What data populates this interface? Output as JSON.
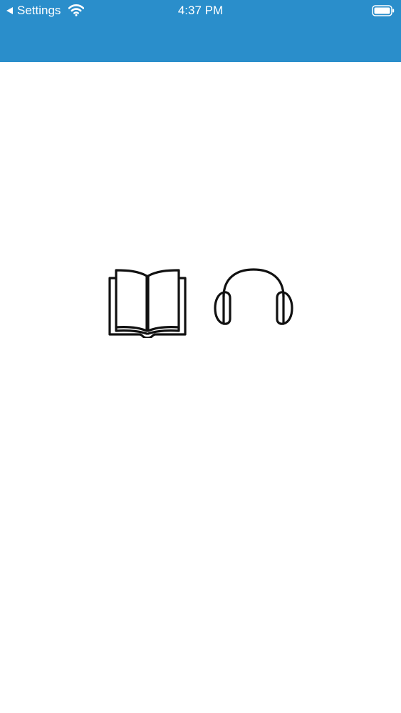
{
  "status_bar": {
    "back_label": "Settings",
    "time": "4:37 PM",
    "wifi_icon": "wifi-icon",
    "battery_icon": "battery-icon"
  },
  "header": {
    "background_color": "#2a8ecb"
  },
  "content": {
    "options": [
      {
        "icon": "book-icon"
      },
      {
        "icon": "headphones-icon"
      }
    ]
  }
}
